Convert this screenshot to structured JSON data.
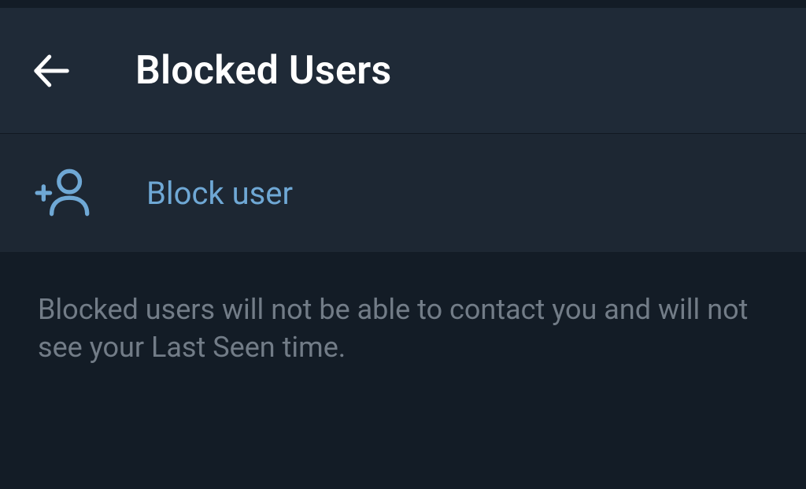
{
  "header": {
    "title": "Blocked Users"
  },
  "action": {
    "label": "Block user"
  },
  "description": {
    "text": "Blocked users will not be able to contact you and will not see your Last Seen time."
  },
  "colors": {
    "accent": "#6fa8d5",
    "header_bg": "#1f2a37",
    "row_bg": "#1d2733",
    "page_bg": "#131c26",
    "muted_text": "#727c87"
  }
}
